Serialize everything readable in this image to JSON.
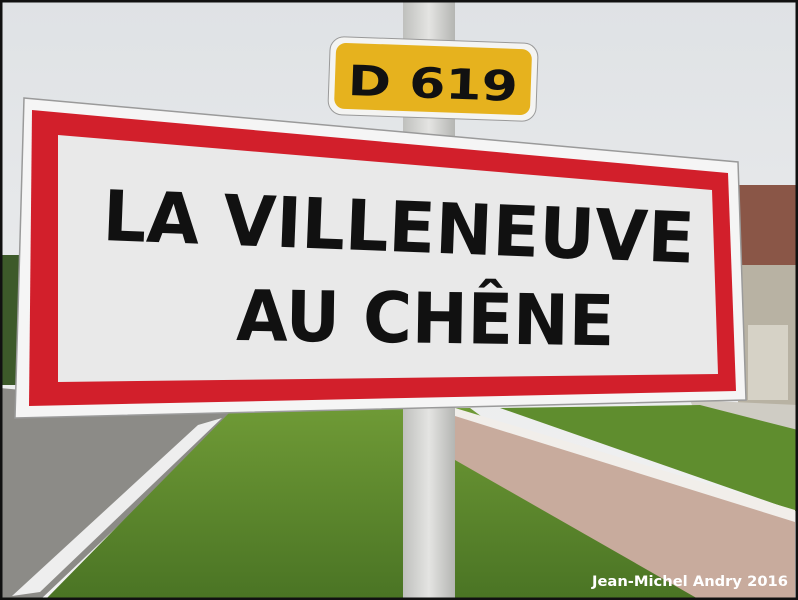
{
  "photo": {
    "road_number_plate": "D 619",
    "sign_line_1": "LA VILLENEUVE",
    "sign_line_2": "AU CHÊNE",
    "credit": "Jean-Michel Andry 2016"
  },
  "colors": {
    "sign_red": "#d21f2b",
    "plate_yellow": "#e6b21e",
    "grass": "#5e8a2c",
    "sky": "#ebedef"
  }
}
